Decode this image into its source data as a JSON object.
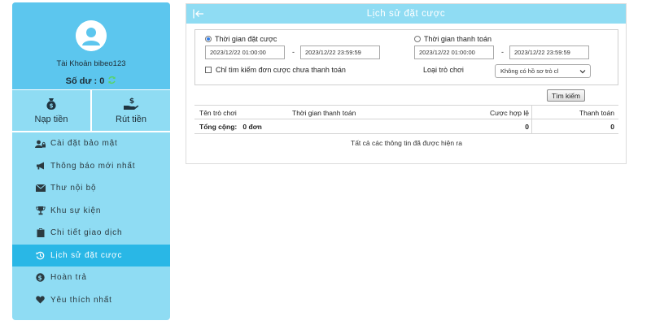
{
  "sidebar": {
    "account_label": "Tài Khoản bibeo123",
    "balance_label": "Số dư : 0",
    "deposit_label": "Nạp tiền",
    "withdraw_label": "Rút tiền",
    "menu": [
      {
        "label": "Cài đặt bảo mật",
        "icon": "user-lock-icon"
      },
      {
        "label": "Thông báo mới nhất",
        "icon": "megaphone-icon"
      },
      {
        "label": "Thư nội bộ",
        "icon": "envelope-icon"
      },
      {
        "label": "Khu sự kiện",
        "icon": "trophy-icon"
      },
      {
        "label": "Chi tiết giao dịch",
        "icon": "clipboard-icon"
      },
      {
        "label": "Lịch sử đặt cược",
        "icon": "history-icon",
        "active": true
      },
      {
        "label": "Hoàn trả",
        "icon": "dollar-coin-icon"
      },
      {
        "label": "Yêu thích nhất",
        "icon": "heart-icon"
      }
    ]
  },
  "panel": {
    "title": "Lịch sử đặt cược",
    "filter": {
      "bet_time_label": "Thời gian đặt cược",
      "bet_time_selected": true,
      "bet_from": "2023/12/22 01:00:00",
      "bet_to": "2023/12/22 23:59:59",
      "pay_time_label": "Thời gian thanh toán",
      "pay_time_selected": false,
      "pay_from": "2023/12/22 01:00:00",
      "pay_to": "2023/12/22 23:59:59",
      "dash": "-",
      "unpaid_only_label": "Chỉ tìm kiếm đơn cược chưa thanh toán",
      "game_type_label": "Loại trò chơi",
      "game_type_value": "Không có hồ sơ trò cl"
    },
    "search_label": "Tìm kiếm",
    "table": {
      "headers": [
        "Tên trò chơi",
        "Thời gian thanh toán",
        "Cược hợp lệ",
        "Thanh toán"
      ],
      "total_label": "Tổng cộng:",
      "total_count": "0 đơn",
      "total_valid_bet": "0",
      "total_payout": "0"
    },
    "note": "Tất cả các thông tin đã được hiện ra"
  },
  "colors": {
    "sidebar_bg": "#8fdcf3",
    "profile_bg": "#5cc6ee",
    "active_item": "#29b7e6",
    "header_bg": "#8fdcf3",
    "refresh": "#58d36a"
  }
}
